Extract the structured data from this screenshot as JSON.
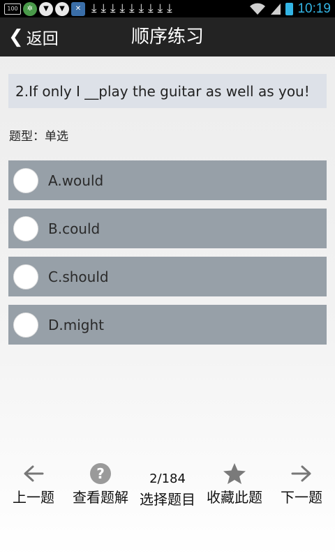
{
  "status_bar": {
    "time": "10:19",
    "left_icons": [
      "battery-100-icon",
      "app-icon-green",
      "shield-icon",
      "shield-icon",
      "app-icon-blue"
    ],
    "battery_small_text": "100",
    "download_arrow_count_text": "↓"
  },
  "header": {
    "back_label": "返回",
    "back_chevron": "❮",
    "title": "顺序练习"
  },
  "question": {
    "text": "2.If only I __play the guitar as well as you!",
    "type_label": "题型：单选"
  },
  "options": [
    {
      "label": "A.would"
    },
    {
      "label": "B.could"
    },
    {
      "label": "C.should"
    },
    {
      "label": "D.might"
    }
  ],
  "bottom_nav": {
    "prev_label": "上一题",
    "explain_label": "查看题解",
    "select_label": "选择题目",
    "favorite_label": "收藏此题",
    "next_label": "下一题",
    "progress": "2/184"
  },
  "colors": {
    "header_bg": "#232323",
    "option_bg": "#97a0a8",
    "question_bg": "#dde1e8",
    "time_color": "#33b5e5"
  }
}
